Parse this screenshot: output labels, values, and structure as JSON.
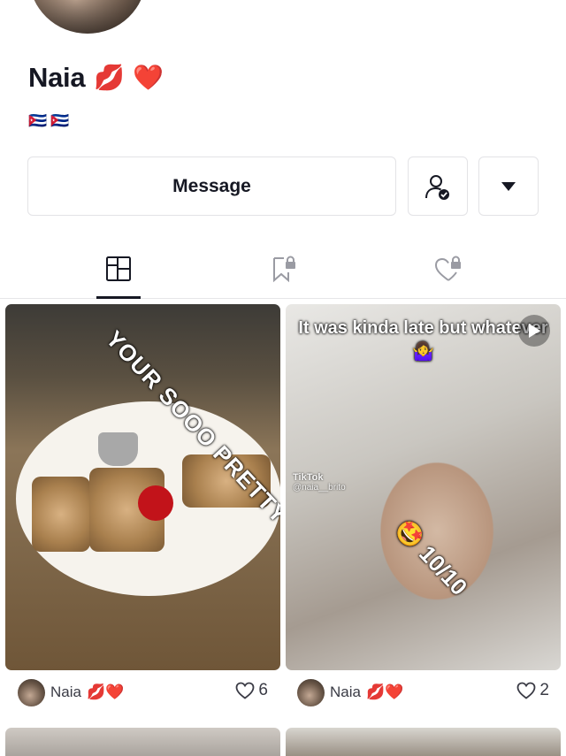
{
  "profile": {
    "name": "Naia",
    "name_emojis": "💋 ❤️",
    "bio": "🇨🇺🇨🇺"
  },
  "actions": {
    "message_label": "Message",
    "follow_icon": "user-check-icon",
    "more_icon": "caret-down-icon"
  },
  "tabs": [
    {
      "id": "videos",
      "icon": "grid-icon",
      "active": true
    },
    {
      "id": "saved",
      "icon": "bookmark-lock-icon",
      "active": false
    },
    {
      "id": "liked",
      "icon": "heart-lock-icon",
      "active": false
    }
  ],
  "posts": [
    {
      "overlay": "YOUR SOOO PRETTY",
      "author": "Naia",
      "author_emojis": "💋❤️",
      "likes": "6"
    },
    {
      "overlay": "It was kinda late but whatever 🤷‍♀️",
      "overlay_rating": "🤩 10/10",
      "watermark_brand": "TikTok",
      "watermark_handle": "@naia__brito",
      "author": "Naia",
      "author_emojis": "💋❤️",
      "likes": "2"
    }
  ],
  "colors": {
    "text": "#161823",
    "border": "#e3e3e6",
    "muted": "#3a3b45"
  }
}
